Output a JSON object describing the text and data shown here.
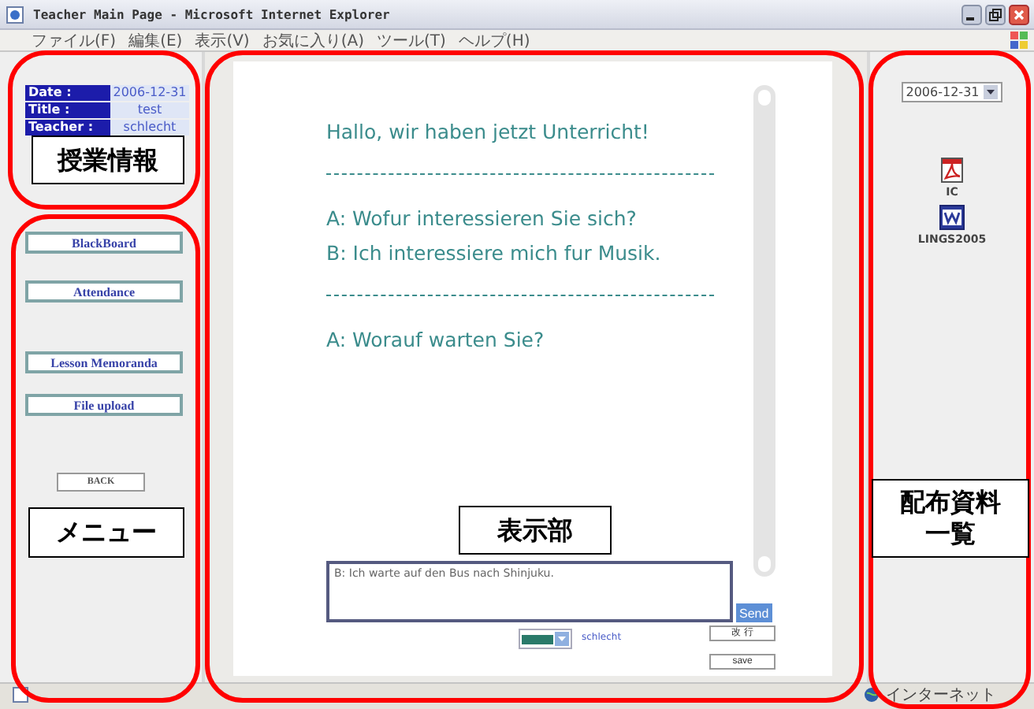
{
  "window": {
    "title": "Teacher Main Page - Microsoft Internet Explorer"
  },
  "menu": [
    "ファイル(F)",
    "編集(E)",
    "表示(V)",
    "お気に入り(A)",
    "ツール(T)",
    "ヘルプ(H)"
  ],
  "lesson_info": [
    {
      "label": "Date :",
      "value": "2006-12-31"
    },
    {
      "label": "Title :",
      "value": "test"
    },
    {
      "label": "Teacher :",
      "value": "schlecht"
    }
  ],
  "nav_buttons": [
    "BlackBoard",
    "Attendance",
    "Lesson Memoranda",
    "File upload",
    "BACK"
  ],
  "chat": {
    "lines": [
      {
        "kind": "message",
        "text": "Hallo, wir haben jetzt Unterricht!"
      },
      {
        "kind": "divider"
      },
      {
        "kind": "message",
        "text": "A: Wofur interessieren Sie sich?"
      },
      {
        "kind": "message",
        "text": "B: Ich interessiere mich fur Musik."
      },
      {
        "kind": "divider"
      },
      {
        "kind": "message",
        "text": "A: Worauf warten Sie?"
      }
    ],
    "input_value": "B: Ich warte auf den Bus nach Shinjuku.",
    "send_button": "Send",
    "user_name": "schlecht",
    "newline_button": "改 行",
    "save_button": "save"
  },
  "materials": {
    "date": "2006-12-31",
    "files": [
      {
        "kind": "pdf",
        "name": "IC"
      },
      {
        "kind": "word",
        "name": "LINGS2005"
      }
    ]
  },
  "status_bar": {
    "zone": "インターネット"
  },
  "annotations": [
    {
      "lines": [
        "授業情報"
      ]
    },
    {
      "lines": [
        "メニュー"
      ]
    },
    {
      "lines": [
        "表示部"
      ]
    },
    {
      "lines": [
        "配布資料",
        "一覧"
      ]
    }
  ]
}
